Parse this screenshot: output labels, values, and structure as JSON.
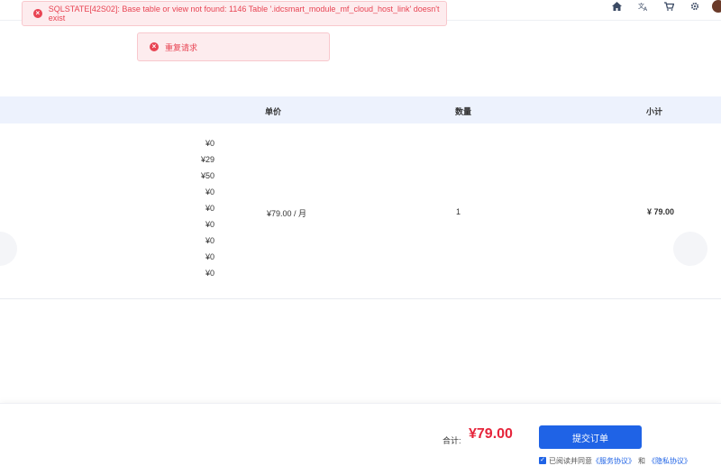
{
  "alerts": {
    "error_1": "SQLSTATE[42S02]: Base table or view not found: 1146 Table '.idcsmart_module_mf_cloud_host_link' doesn't exist",
    "error_2": "重复请求"
  },
  "table": {
    "headers": {
      "unit_price": "单价",
      "quantity": "数量",
      "subtotal": "小计"
    },
    "row": {
      "option_prices": [
        "¥0",
        "¥29",
        "¥50",
        "¥0",
        "¥0",
        "¥0",
        "¥0",
        "¥0",
        "¥0"
      ],
      "unit_price": "¥79.00 / 月",
      "quantity": "1",
      "subtotal": "¥ 79.00"
    }
  },
  "footer": {
    "total_label": "合计:",
    "total_value": "¥79.00",
    "submit_label": "提交订单",
    "agree_text": "已阅读并同意",
    "service_link": "《服务协议》",
    "and_text": "和",
    "privacy_link": "《隐私协议》"
  }
}
